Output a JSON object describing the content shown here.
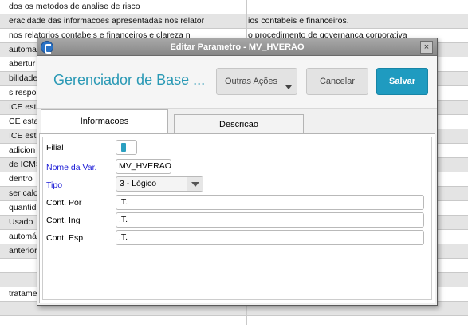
{
  "background": {
    "rows": [
      {
        "col1": "dos os metodos de analise de risco",
        "col2": ""
      },
      {
        "col1": "eracidade das informacoes apresentadas nos relator",
        "col2": "ios contabeis e financeiros."
      },
      {
        "col1": "nos relatorios contabeis e financeiros e clareza n",
        "col2": "o procedimento de governanca corporativa"
      },
      {
        "col1": "automa",
        "col2": ""
      },
      {
        "col1": "abertur",
        "col2": ""
      },
      {
        "col1": "bilidade",
        "col2": ""
      },
      {
        "col1": "s respo",
        "col2": ""
      },
      {
        "col1": "ICE esta",
        "col2": ""
      },
      {
        "col1": "CE esta",
        "col2": ""
      },
      {
        "col1": "ICE esta",
        "col2": ""
      },
      {
        "col1": "adicion",
        "col2": ""
      },
      {
        "col1": "de ICMS",
        "col2": ""
      },
      {
        "col1": "dentro",
        "col2": ""
      },
      {
        "col1": "ser calc",
        "col2": ""
      },
      {
        "col1": "quantid",
        "col2": ""
      },
      {
        "col1": "Usado",
        "col2": ""
      },
      {
        "col1": "automá",
        "col2": ""
      },
      {
        "col1": "anterior",
        "col2": ""
      },
      {
        "col1": "",
        "col2": ""
      },
      {
        "col1": "",
        "col2": ""
      },
      {
        "col1": " tratame",
        "col2": ""
      },
      {
        "col1": "",
        "col2": ""
      },
      {
        "col1": "",
        "col2": ""
      }
    ]
  },
  "dialog": {
    "title": "Editar Parametro - MV_HVERAO",
    "close_glyph": "×",
    "header_title": "Gerenciador de Base ...",
    "buttons": {
      "more_actions": "Outras Ações",
      "cancel": "Cancelar",
      "save": "Salvar"
    },
    "tabs": {
      "info": "Informacoes",
      "desc": "Descricao"
    },
    "form": {
      "filial_label": "Filial",
      "nome_label": "Nome da Var.",
      "nome_value": "MV_HVERAO",
      "tipo_label": "Tipo",
      "tipo_value": "3 - Lógico",
      "cont_por_label": "Cont. Por",
      "cont_por_value": ".T.",
      "cont_ing_label": "Cont. Ing",
      "cont_ing_value": ".T.",
      "cont_esp_label": "Cont. Esp",
      "cont_esp_value": ".T."
    }
  },
  "colors": {
    "accent": "#1f9bc0",
    "header_title": "#2a99b5",
    "required_label": "#1a1ad6",
    "titlebar": "#8f8f8f"
  },
  "icons": {
    "app_logo": "totvs-logo-icon",
    "close": "close-icon",
    "dropdown": "chevron-down-icon"
  }
}
